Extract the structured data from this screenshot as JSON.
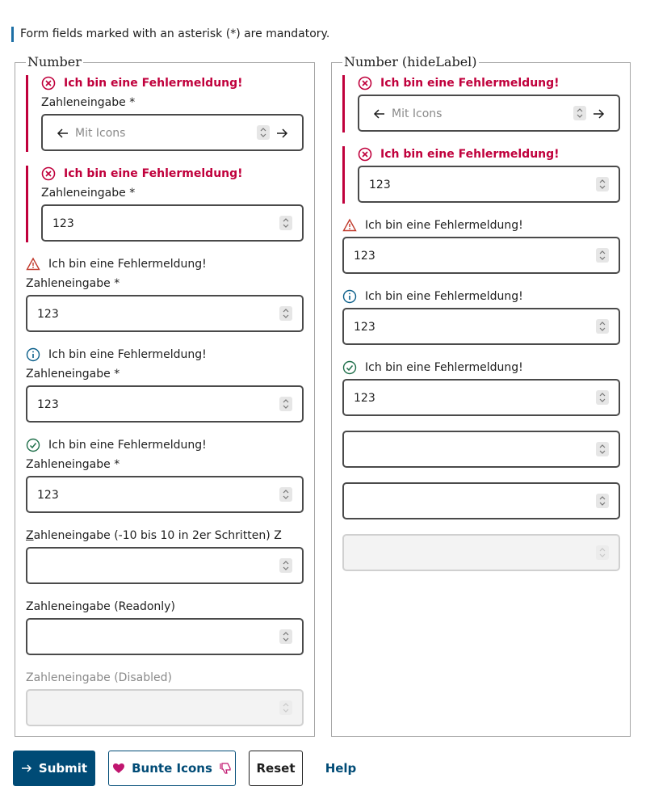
{
  "notice": "Form fields marked with an asterisk (*) are mandatory.",
  "colors": {
    "error": "#c0003c",
    "warning": "#c0392b",
    "info": "#0b5f8a",
    "success": "#1f6f4a",
    "primary": "#004b76"
  },
  "left": {
    "legend": "Number",
    "error_msg_1": "Ich bin eine Fehlermeldung!",
    "label_1": "Zahleneingabe",
    "required_1": "*",
    "placeholder_1": "Mit Icons",
    "error_msg_2": "Ich bin eine Fehlermeldung!",
    "label_2": "Zahleneingabe",
    "required_2": "*",
    "value_2": "123",
    "warn_msg": "Ich bin eine Fehlermeldung!",
    "label_3": "Zahleneingabe",
    "required_3": "*",
    "value_3": "123",
    "info_msg": "Ich bin eine Fehlermeldung!",
    "label_4": "Zahleneingabe",
    "required_4": "*",
    "value_4": "123",
    "success_msg": "Ich bin eine Fehlermeldung!",
    "label_5": "Zahleneingabe",
    "required_5": "*",
    "value_5": "123",
    "label_6_access": "Z",
    "label_6": "ahleneingabe (-10 bis 10 in 2er Schritten) Z",
    "label_7": "Zahleneingabe (Readonly)",
    "label_8": "Zahleneingabe (Disabled)"
  },
  "right": {
    "legend": "Number (hideLabel)",
    "error_msg_1": "Ich bin eine Fehlermeldung!",
    "placeholder_1": "Mit Icons",
    "error_msg_2": "Ich bin eine Fehlermeldung!",
    "value_2": "123",
    "warn_msg": "Ich bin eine Fehlermeldung!",
    "value_3": "123",
    "info_msg": "Ich bin eine Fehlermeldung!",
    "value_4": "123",
    "success_msg": "Ich bin eine Fehlermeldung!",
    "value_5": "123"
  },
  "buttons": {
    "submit": "Submit",
    "bunte": "Bunte Icons",
    "reset": "Reset",
    "help": "Help"
  }
}
